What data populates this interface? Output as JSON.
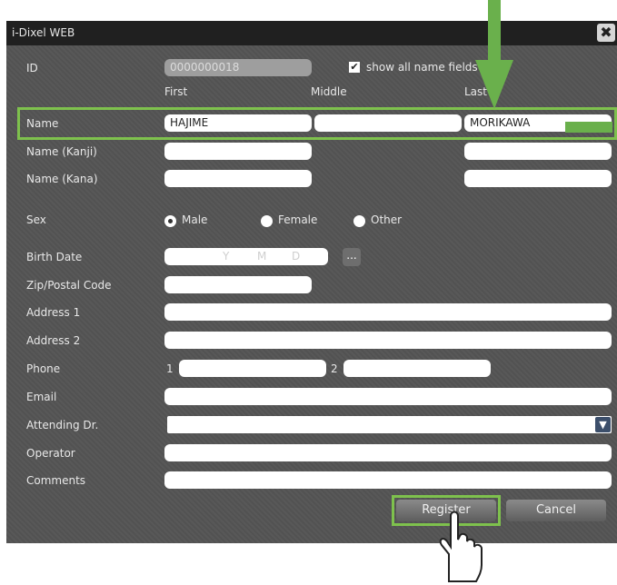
{
  "window": {
    "title": "i-Dixel WEB",
    "close_glyph": "✖"
  },
  "form": {
    "id_label": "ID",
    "id_value": "0000000018",
    "show_all_label": "show all name fields",
    "col_first": "First",
    "col_middle": "Middle",
    "col_last": "Last",
    "name_label": "Name",
    "name_first": "HAJIME",
    "name_middle": "",
    "name_last": "MORIKAWA",
    "kanji_label": "Name (Kanji)",
    "kana_label": "Name (Kana)",
    "sex_label": "Sex",
    "sex_male": "Male",
    "sex_female": "Female",
    "sex_other": "Other",
    "sex_selected": "Male",
    "birth_label": "Birth Date",
    "birth_placeholder_y": "Y",
    "birth_placeholder_m": "M",
    "birth_placeholder_d": "D",
    "calendar_button": "...",
    "zip_label": "Zip/Postal Code",
    "address1_label": "Address 1",
    "address2_label": "Address 2",
    "phone_label": "Phone",
    "phone1_prefix": "1",
    "phone2_prefix": "2",
    "email_label": "Email",
    "attending_label": "Attending Dr.",
    "operator_label": "Operator",
    "comments_label": "Comments"
  },
  "buttons": {
    "register": "Register",
    "cancel": "Cancel"
  },
  "colors": {
    "highlight": "#7ec14d",
    "arrow": "#6ab04c"
  }
}
